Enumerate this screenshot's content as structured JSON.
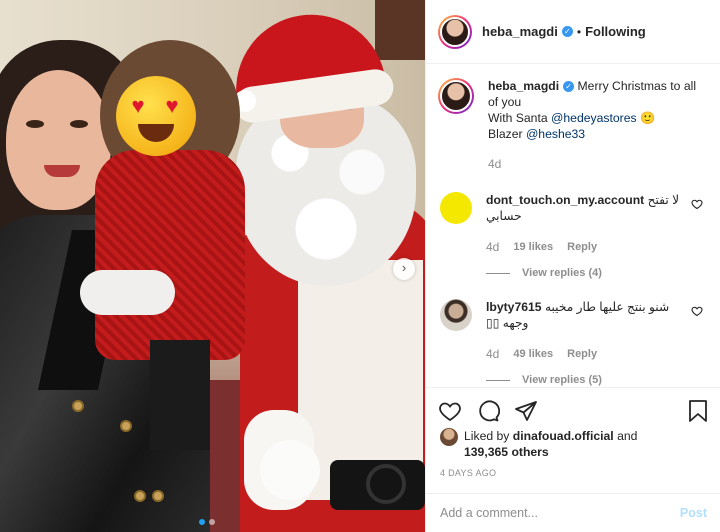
{
  "post": {
    "username": "heba_magdi",
    "follow_status": "Following",
    "bullet": "•",
    "caption_text": "Merry Christmas to all of you",
    "caption_line2_prefix": "With Santa",
    "caption_mention1": "@hedeyastores",
    "caption_emoji": "🙂",
    "caption_line3_prefix": "Blazer",
    "caption_mention2": "@heshe33",
    "caption_time": "4d"
  },
  "comments": [
    {
      "username": "dont_touch.on_my.account",
      "text": "لا تفتح حسابي",
      "time": "4d",
      "likes": "19 likes",
      "reply": "Reply",
      "view_replies": "View replies (4)",
      "avatar_color": "#f5e800"
    },
    {
      "username": "lbyty7615",
      "text": "شنو بنتج عليها طار مخيبه وجهه ▯▯",
      "time": "4d",
      "likes": "49 likes",
      "reply": "Reply",
      "view_replies": "View replies (5)",
      "avatar_color": "#a99a86"
    }
  ],
  "likes": {
    "prefix": "Liked by",
    "user": "dinafouad.official",
    "and": "and",
    "count": "139,365 others"
  },
  "posted_ago": "4 DAYS AGO",
  "add_comment": {
    "placeholder": "Add a comment...",
    "post_label": "Post"
  },
  "carousel": {
    "next_arrow": "›",
    "current_index": 1,
    "total": 2
  },
  "colors": {
    "accent": "#3897f0",
    "post_disabled": "#b2dffc",
    "secondary_text": "#8e8e8e"
  },
  "icons": [
    "verified-badge-icon",
    "heart-icon",
    "comment-icon",
    "share-icon",
    "bookmark-icon",
    "next-arrow-icon"
  ]
}
